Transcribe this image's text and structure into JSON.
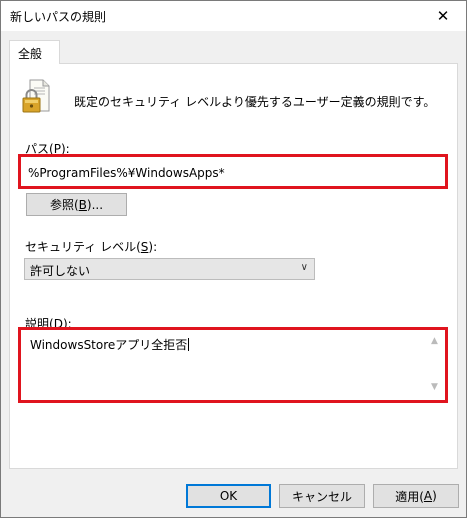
{
  "window": {
    "title": "新しいパスの規則"
  },
  "tabs": [
    {
      "label": "全般"
    }
  ],
  "intro": {
    "text": "既定のセキュリティ レベルより優先するユーザー定義の規則です。"
  },
  "path": {
    "label": "パス(",
    "accel": "P",
    "label_end": "):",
    "value": "%ProgramFiles%¥WindowsApps*",
    "browse_button": {
      "label": "参照(",
      "accel": "B",
      "label_end": ")..."
    }
  },
  "security": {
    "label": "セキュリティ レベル(",
    "accel": "S",
    "label_end": "):",
    "selected": "許可しない"
  },
  "description": {
    "label": "説明(",
    "accel": "D",
    "label_end": "):",
    "value": "WindowsStoreアプリ全拒否"
  },
  "buttons": {
    "ok": "OK",
    "cancel": "キャンセル",
    "apply": "適用(",
    "apply_accel": "A",
    "apply_end": ")"
  },
  "icons": {
    "close": "close-icon",
    "lock": "lock-document-icon",
    "combo": "chevron-down-icon"
  },
  "colors": {
    "highlight": "#e0141e",
    "accent": "#0078d7"
  }
}
